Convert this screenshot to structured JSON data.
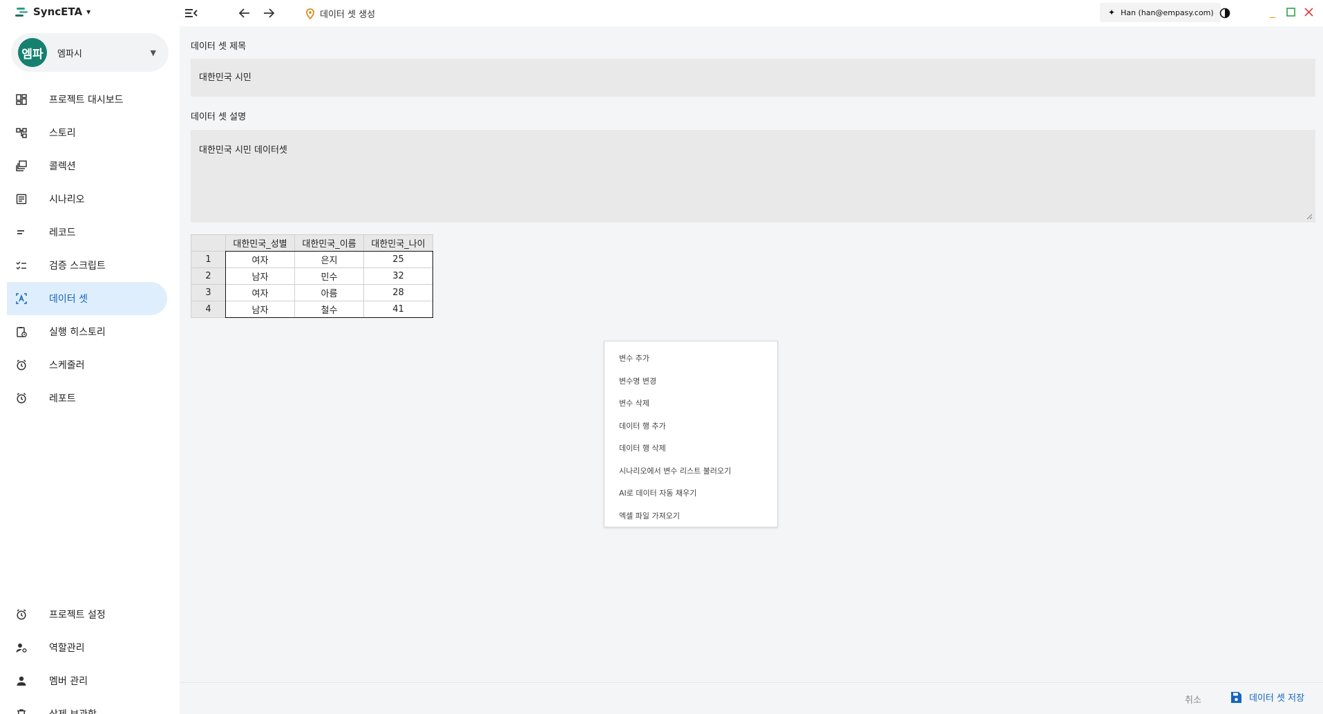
{
  "app": {
    "name": "SyncETA"
  },
  "breadcrumb": {
    "current": "데이터 셋 생성"
  },
  "user": {
    "label": "Han (han@empasy.com)"
  },
  "project": {
    "avatar_text": "엠파",
    "name": "엠파시"
  },
  "sidebar": {
    "items": [
      {
        "label": "프로젝트 대시보드",
        "icon": "dashboard-icon"
      },
      {
        "label": "스토리",
        "icon": "story-icon"
      },
      {
        "label": "콜렉션",
        "icon": "collection-icon"
      },
      {
        "label": "시나리오",
        "icon": "scenario-icon"
      },
      {
        "label": "레코드",
        "icon": "record-icon"
      },
      {
        "label": "검증 스크립트",
        "icon": "checklist-icon"
      },
      {
        "label": "데이터 셋",
        "icon": "dataset-icon",
        "active": true
      },
      {
        "label": "실행 히스토리",
        "icon": "history-icon"
      },
      {
        "label": "스케줄러",
        "icon": "alarm-icon"
      },
      {
        "label": "레포트",
        "icon": "alarm-icon"
      }
    ],
    "bottom_items": [
      {
        "label": "프로젝트 설정",
        "icon": "alarm-icon"
      },
      {
        "label": "역할관리",
        "icon": "role-icon"
      },
      {
        "label": "멤버 관리",
        "icon": "person-icon"
      },
      {
        "label": "삭제 보관함",
        "icon": "trash-icon"
      }
    ]
  },
  "form": {
    "title_label": "데이터 셋 제목",
    "title_value": "대한민국 시민",
    "desc_label": "데이터 셋 설명",
    "desc_value": "대한민국 시민 데이터셋"
  },
  "grid": {
    "columns": [
      "대한민국_성별",
      "대한민국_이름",
      "대한민국_나이"
    ],
    "rows": [
      {
        "num": "1",
        "cells": [
          "여자",
          "은지",
          "25"
        ]
      },
      {
        "num": "2",
        "cells": [
          "남자",
          "민수",
          "32"
        ]
      },
      {
        "num": "3",
        "cells": [
          "여자",
          "아름",
          "28"
        ]
      },
      {
        "num": "4",
        "cells": [
          "남자",
          "철수",
          "41"
        ]
      }
    ]
  },
  "context_menu": {
    "items": [
      "변수 추가",
      "변수명 변경",
      "변수 삭제",
      "데이터 행 추가",
      "데이터 행 삭제",
      "시나리오에서 변수 리스트 불러오기",
      "AI로 데이터 자동 채우기",
      "엑셀 파일 가져오기"
    ]
  },
  "footer": {
    "cancel_label": "취소",
    "save_label": "데이터 셋 저장"
  },
  "colors": {
    "accent": "#1565c0",
    "active_bg": "#deeefc",
    "avatar_bg": "#15806f",
    "minimize": "#e8a300",
    "maximize": "#2ea043",
    "close": "#e53935"
  }
}
